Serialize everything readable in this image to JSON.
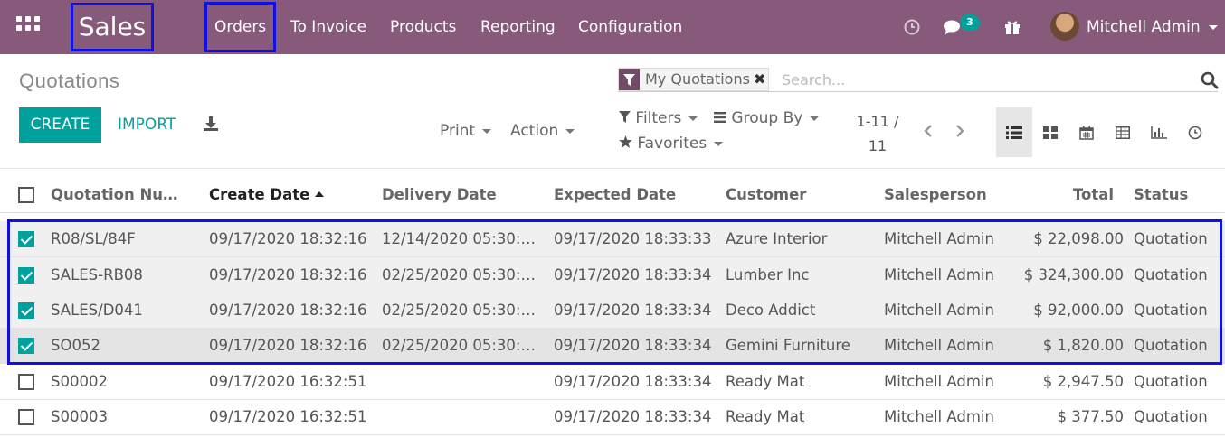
{
  "navbar": {
    "app_title": "Sales",
    "menu": [
      "Orders",
      "To Invoice",
      "Products",
      "Reporting",
      "Configuration"
    ],
    "chat_badge": "3",
    "user_name": "Mitchell Admin",
    "icons": [
      "apps-grid-icon",
      "clock-icon",
      "chat-icon",
      "gift-icon",
      "avatar"
    ]
  },
  "control_panel": {
    "title": "Quotations",
    "create_label": "CREATE",
    "import_label": "IMPORT",
    "print_label": "Print",
    "action_label": "Action",
    "filters_label": "Filters",
    "group_by_label": "Group By",
    "favorites_label": "Favorites",
    "facet_label": "My Quotations",
    "search_placeholder": "Search...",
    "pager_range": "1-11 /",
    "pager_total": "11"
  },
  "table": {
    "columns": [
      "Quotation Nu…",
      "Create Date",
      "Delivery Date",
      "Expected Date",
      "Customer",
      "Salesperson",
      "Total",
      "Status"
    ],
    "sorted_column": "Create Date",
    "rows": [
      {
        "checked": true,
        "number": "R08/SL/84F",
        "create_date": "09/17/2020 18:32:16",
        "delivery_date": "12/14/2020 05:30:…",
        "expected_date": "09/17/2020 18:33:33",
        "customer": "Azure Interior",
        "salesperson": "Mitchell Admin",
        "total": "$ 22,098.00",
        "status": "Quotation"
      },
      {
        "checked": true,
        "number": "SALES-RB08",
        "create_date": "09/17/2020 18:32:16",
        "delivery_date": "02/25/2020 05:30:…",
        "expected_date": "09/17/2020 18:33:34",
        "customer": "Lumber Inc",
        "salesperson": "Mitchell Admin",
        "total": "$ 324,300.00",
        "status": "Quotation"
      },
      {
        "checked": true,
        "number": "SALES/D041",
        "create_date": "09/17/2020 18:32:16",
        "delivery_date": "02/25/2020 05:30:…",
        "expected_date": "09/17/2020 18:33:34",
        "customer": "Deco Addict",
        "salesperson": "Mitchell Admin",
        "total": "$ 92,000.00",
        "status": "Quotation"
      },
      {
        "checked": true,
        "number": "SO052",
        "create_date": "09/17/2020 18:32:16",
        "delivery_date": "02/25/2020 05:30:…",
        "expected_date": "09/17/2020 18:33:34",
        "customer": "Gemini Furniture",
        "salesperson": "Mitchell Admin",
        "total": "$ 1,820.00",
        "status": "Quotation"
      },
      {
        "checked": false,
        "number": "S00002",
        "create_date": "09/17/2020 16:32:51",
        "delivery_date": "",
        "expected_date": "09/17/2020 18:33:34",
        "customer": "Ready Mat",
        "salesperson": "Mitchell Admin",
        "total": "$ 2,947.50",
        "status": "Quotation"
      },
      {
        "checked": false,
        "number": "S00003",
        "create_date": "09/17/2020 16:32:51",
        "delivery_date": "",
        "expected_date": "09/17/2020 18:33:34",
        "customer": "Ready Mat",
        "salesperson": "Mitchell Admin",
        "total": "$ 377.50",
        "status": "Quotation"
      }
    ]
  },
  "colors": {
    "navbar": "#875a7b",
    "primary": "#00a09d",
    "highlight_box": "#1010e0"
  }
}
